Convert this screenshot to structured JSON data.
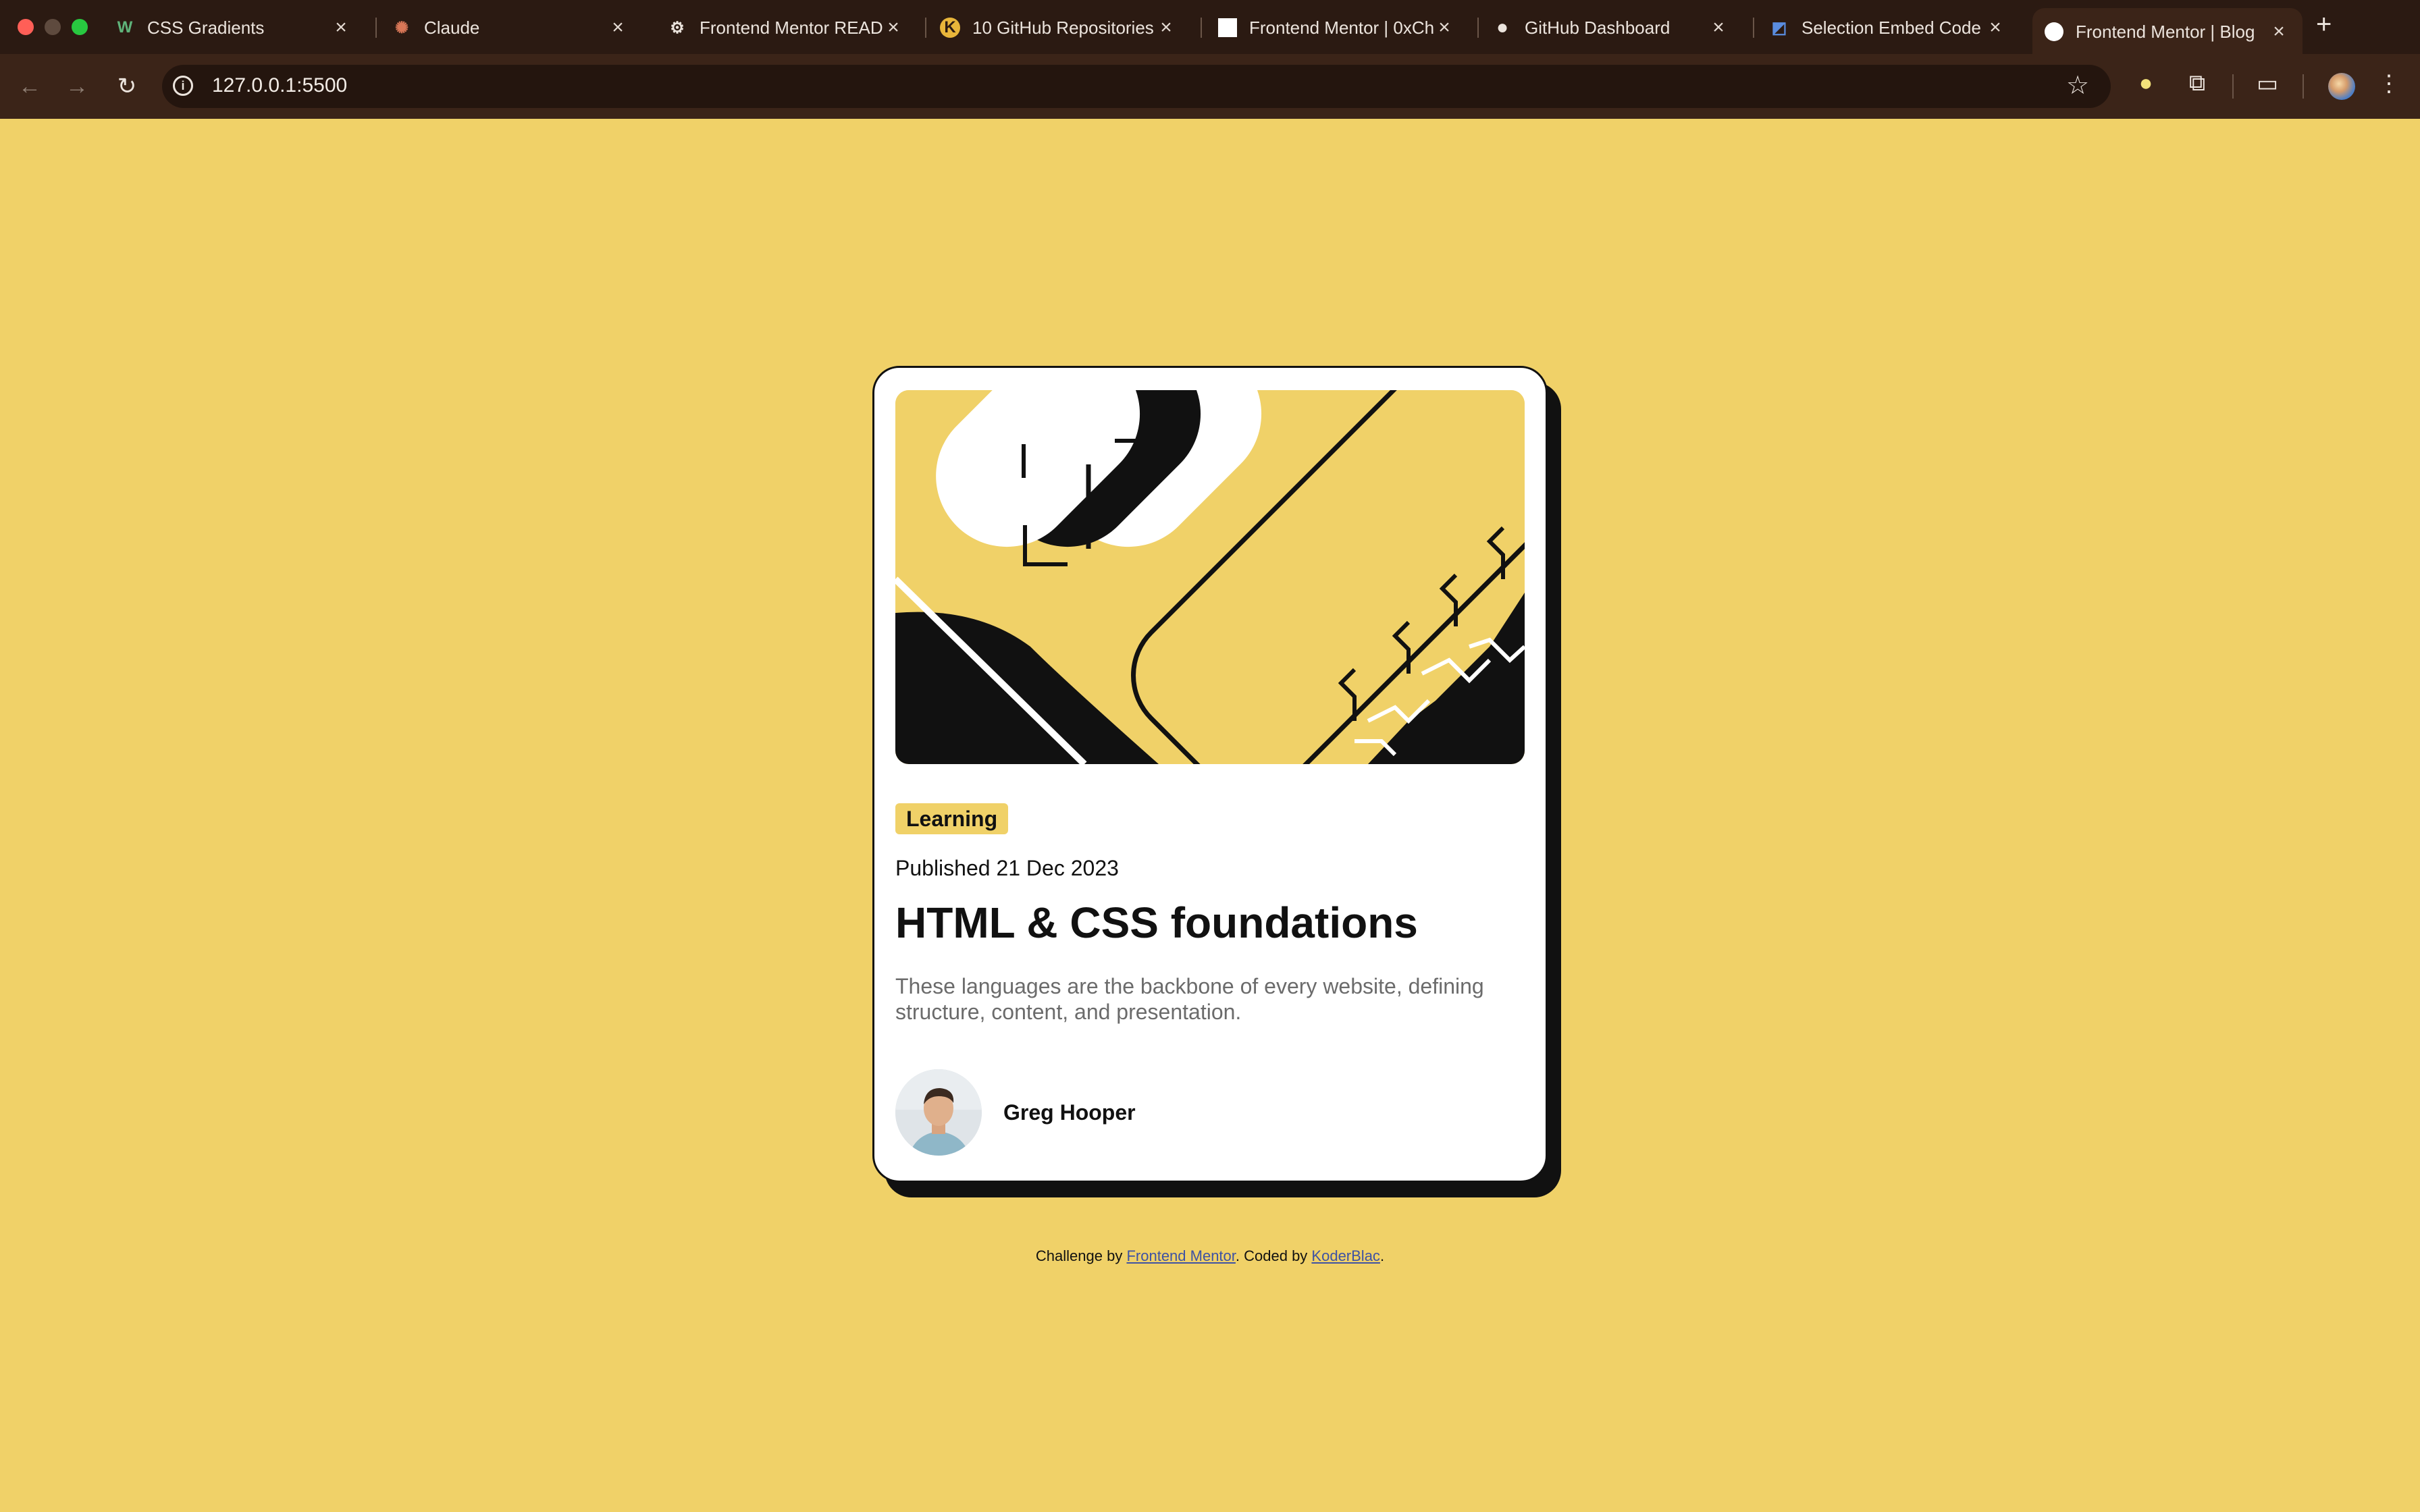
{
  "browser": {
    "tabs": [
      {
        "title": "CSS Gradients",
        "icon": "w-icon"
      },
      {
        "title": "Claude",
        "icon": "claude-icon"
      },
      {
        "title": "Frontend Mentor READM",
        "icon": "openai-icon"
      },
      {
        "title": "10 GitHub Repositories",
        "icon": "k-icon"
      },
      {
        "title": "Frontend Mentor | 0xCh",
        "icon": "page-icon"
      },
      {
        "title": "GitHub Dashboard",
        "icon": "github-icon"
      },
      {
        "title": "Selection Embed Code",
        "icon": "embed-icon"
      },
      {
        "title": "Frontend Mentor | Blog",
        "icon": "page-icon"
      }
    ],
    "url": "127.0.0.1:5500"
  },
  "card": {
    "tag": "Learning",
    "published": "Published 21 Dec 2023",
    "title": "HTML & CSS foundations",
    "description": "These languages are the backbone of every website, defining structure, content, and presentation.",
    "author": "Greg Hooper"
  },
  "footer": {
    "prefix": "Challenge by ",
    "link1": "Frontend Mentor",
    "middle": ". Coded by ",
    "link2": "KoderBlac",
    "suffix": "."
  },
  "colors": {
    "background": "#f0d168",
    "text": "#111111",
    "muted": "#6b6b6b",
    "chrome": "#3b2418"
  }
}
